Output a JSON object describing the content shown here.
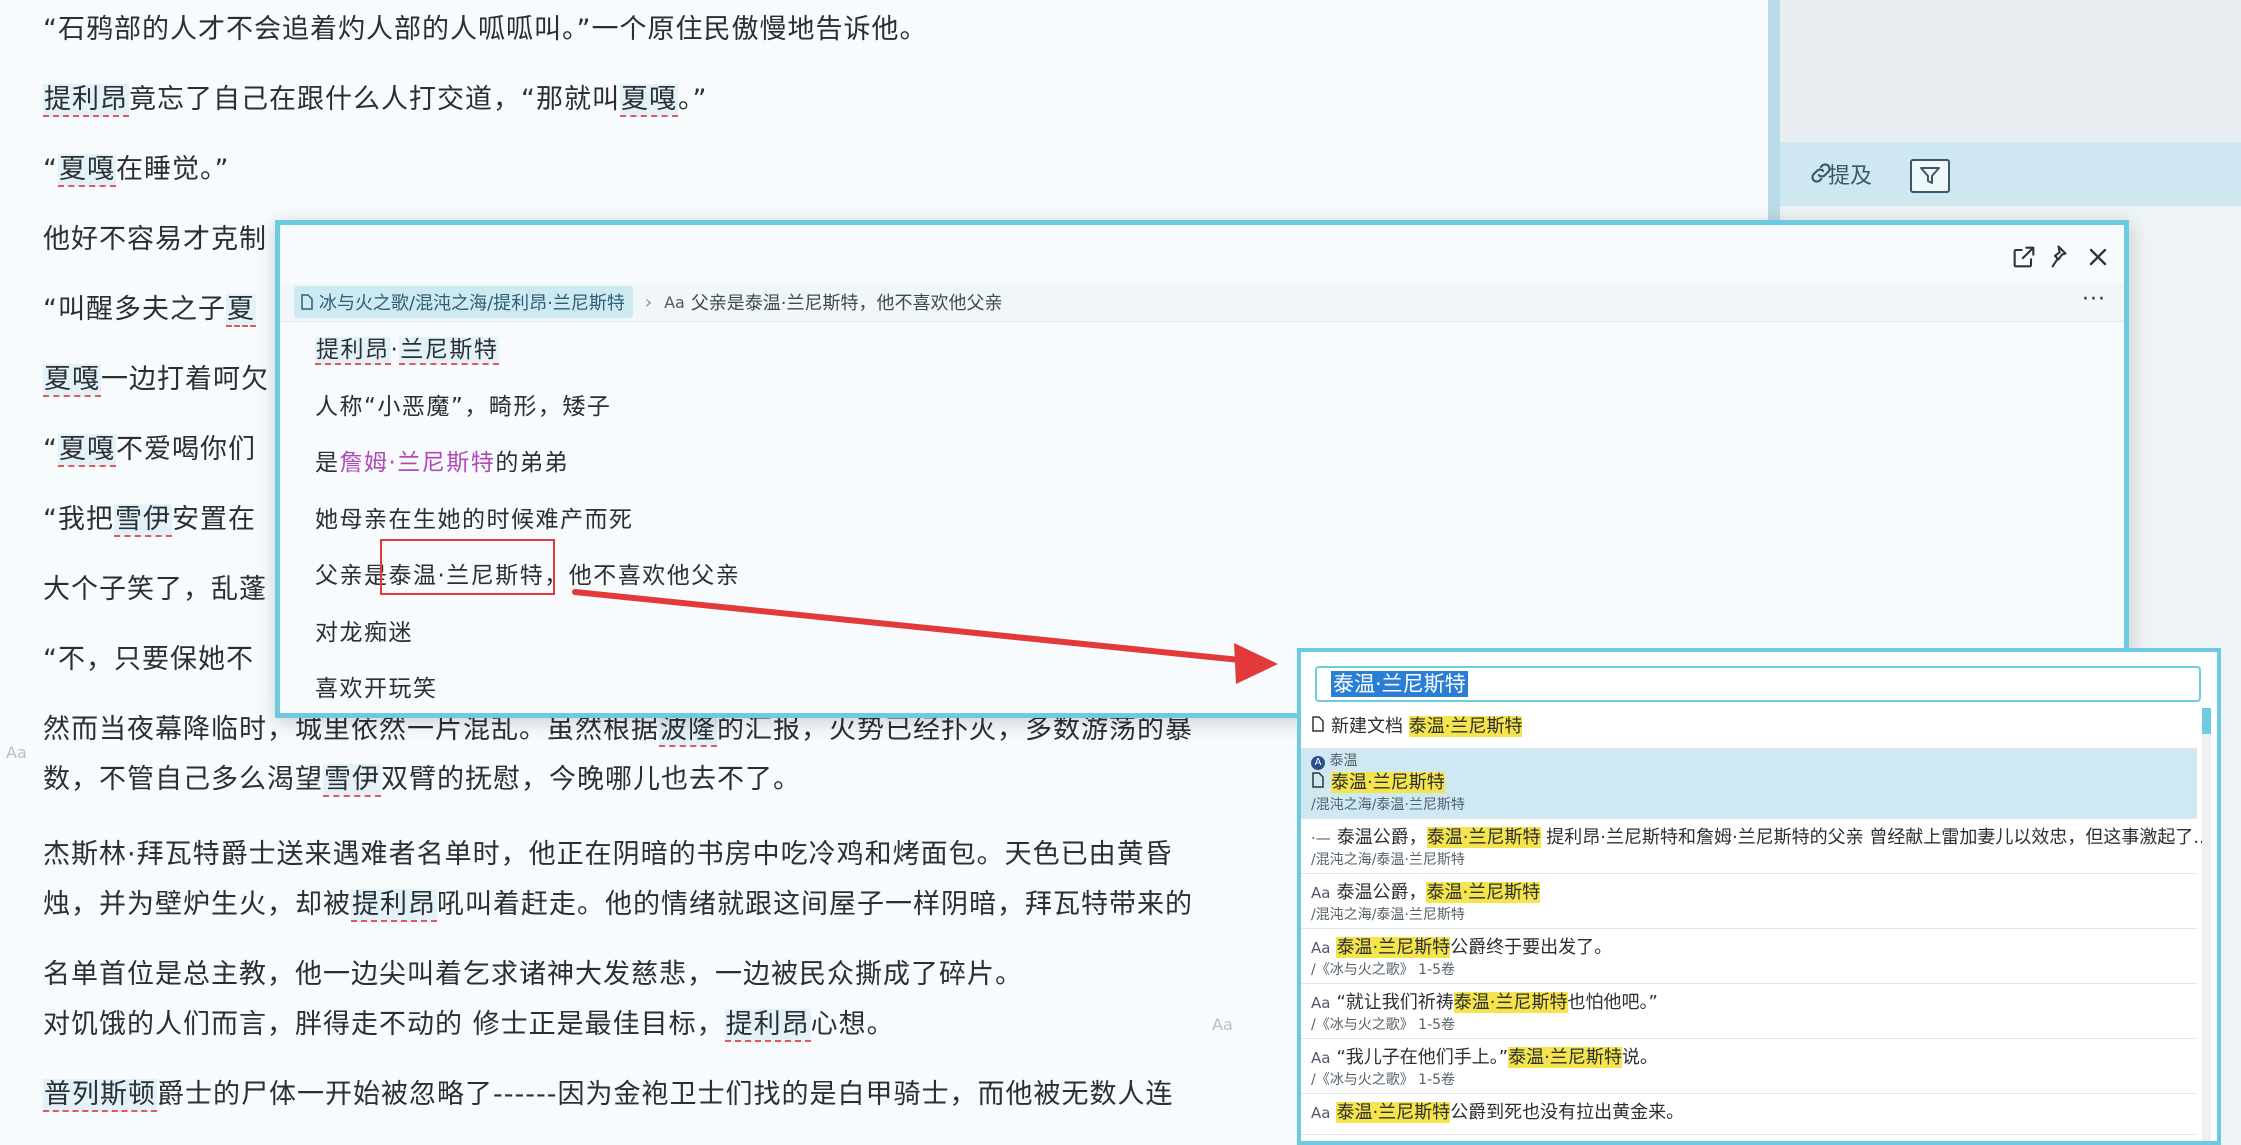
{
  "document": {
    "lines": [
      {
        "parts": [
          {
            "t": "“石鸦部的人才不会追着灼人部的人呱呱叫。”一个原住民傲慢地告诉他。"
          }
        ]
      },
      {
        "parts": [
          {
            "t": "提利昂",
            "link": true
          },
          {
            "t": "竟忘了自己在跟什么人打交道，“那就叫"
          },
          {
            "t": "夏嘎",
            "link": true
          },
          {
            "t": "。”"
          }
        ]
      },
      {
        "parts": [
          {
            "t": "“"
          },
          {
            "t": "夏嘎",
            "link": true
          },
          {
            "t": "在睡觉。”"
          }
        ]
      },
      {
        "parts": [
          {
            "t": "他好不容易才克制"
          }
        ]
      },
      {
        "parts": [
          {
            "t": "“叫醒多夫之子"
          },
          {
            "t": "夏",
            "link": true
          }
        ]
      },
      {
        "parts": [
          {
            "t": "夏嘎",
            "link": true
          },
          {
            "t": "一边打着呵欠"
          }
        ]
      },
      {
        "parts": [
          {
            "t": "“"
          },
          {
            "t": "夏嘎",
            "link": true
          },
          {
            "t": "不爱喝你们"
          }
        ]
      },
      {
        "parts": [
          {
            "t": "“我把"
          },
          {
            "t": "雪伊",
            "link": true
          },
          {
            "t": "安置在"
          }
        ]
      },
      {
        "parts": [
          {
            "t": "大个子笑了，乱蓬"
          }
        ]
      },
      {
        "parts": [
          {
            "t": "“不，只要保她不"
          }
        ]
      },
      {
        "parts": [
          {
            "t": "然而当夜幕降临时，城里依然一片混乱。虽然根据"
          },
          {
            "t": "波隆",
            "link": true
          },
          {
            "t": "的汇报，火势已经扑灭，多数游荡的暴"
          }
        ]
      },
      {
        "parts": [
          {
            "t": "数，不管自己多么渴望"
          },
          {
            "t": "雪伊",
            "link": true
          },
          {
            "t": "双臂的抚慰，今晚哪儿也去不了。"
          }
        ]
      },
      {
        "parts": [
          {
            "t": "杰斯林·拜瓦特爵士送来遇难者名单时，他正在阴暗的书房中吃冷鸡和烤面包。天色已由黄昏"
          }
        ]
      },
      {
        "parts": [
          {
            "t": "烛，并为壁炉生火，却被"
          },
          {
            "t": "提利昂",
            "link": true
          },
          {
            "t": "吼叫着赶走。他的情绪就跟这间屋子一样阴暗，拜瓦特带来的"
          }
        ]
      },
      {
        "parts": [
          {
            "t": "名单首位是总主教，他一边尖叫着乞求诸神大发慈悲，一边被民众撕成了碎片。"
          }
        ]
      },
      {
        "parts": [
          {
            "t": "对饥饿的人们而言，胖得走不动的 修士正是最佳目标，"
          },
          {
            "t": "提利昂",
            "link": true
          },
          {
            "t": "心想。"
          }
        ]
      },
      {
        "parts": [
          {
            "t": "普列斯顿",
            "link": true
          },
          {
            "t": "爵士的尸体一开始被忽略了------因为金袍卫士们找的是白甲骑士，而他被无数人连"
          }
        ]
      }
    ],
    "aa_marks": [
      "Aa",
      "Aa"
    ]
  },
  "sidebar": {
    "mentions_label": "提及",
    "icons": [
      "link-icon",
      "filter-icon"
    ]
  },
  "popover": {
    "breadcrumb_doc": "冰与火之歌/混沌之海/提利昂·兰尼斯特",
    "breadcrumb_block_prefix": "Aa",
    "breadcrumb_block": "父亲是泰温·兰尼斯特，他不喜欢他父亲",
    "more": "···",
    "lines": [
      {
        "parts": [
          {
            "t": "提利昂",
            "link": true
          },
          {
            "t": "·"
          },
          {
            "t": "兰尼斯特",
            "link": true
          }
        ]
      },
      {
        "parts": [
          {
            "t": "人称“小恶魔”，畸形，矮子"
          }
        ]
      },
      {
        "parts": [
          {
            "t": "是"
          },
          {
            "t": "詹姆·兰尼斯特",
            "purple": true
          },
          {
            "t": "的弟弟"
          }
        ]
      },
      {
        "parts": [
          {
            "t": "她母亲在生她的时候难产而死"
          }
        ]
      },
      {
        "parts": [
          {
            "t": "父亲是泰温·兰尼斯特，他不喜欢他父亲"
          }
        ]
      },
      {
        "parts": [
          {
            "t": "对龙痴迷"
          }
        ]
      },
      {
        "parts": [
          {
            "t": "喜欢开玩笑"
          }
        ]
      }
    ]
  },
  "search": {
    "query": "泰温·兰尼斯特",
    "results": [
      {
        "kind": "new-doc",
        "line": [
          {
            "t": "新建文档 "
          },
          {
            "t": "泰温·兰尼斯特",
            "hl": true
          }
        ],
        "path": ""
      },
      {
        "kind": "doc",
        "selected": true,
        "badge": "A",
        "badge_text": "泰温",
        "line": [
          {
            "t": "泰温·兰尼斯特",
            "hl": true
          }
        ],
        "path": "/混沌之海/泰温·兰尼斯特"
      },
      {
        "kind": "list",
        "line": [
          {
            "t": "泰温公爵，"
          },
          {
            "t": "泰温·兰尼斯特",
            "hl": true
          },
          {
            "t": " 提利昂·兰尼斯特和詹姆·兰尼斯特的父亲 曾经献上雷加妻儿以效忠，但这事激起了..."
          }
        ],
        "path": "/混沌之海/泰温·兰尼斯特"
      },
      {
        "kind": "aa",
        "line": [
          {
            "t": "泰温公爵，"
          },
          {
            "t": "泰温·兰尼斯特",
            "hl": true
          }
        ],
        "path": "/混沌之海/泰温·兰尼斯特"
      },
      {
        "kind": "aa",
        "line": [
          {
            "t": "泰温·兰尼斯特",
            "hl": true
          },
          {
            "t": "公爵终于要出发了。"
          }
        ],
        "path": "/《冰与火之歌》 1-5卷"
      },
      {
        "kind": "aa",
        "line": [
          {
            "t": "“就让我们祈祷"
          },
          {
            "t": "泰温·兰尼斯特",
            "hl": true
          },
          {
            "t": "也怕他吧。”"
          }
        ],
        "path": "/《冰与火之歌》 1-5卷"
      },
      {
        "kind": "aa",
        "line": [
          {
            "t": "“我儿子在他们手上。”"
          },
          {
            "t": "泰温·兰尼斯特",
            "hl": true
          },
          {
            "t": "说。"
          }
        ],
        "path": "/《冰与火之歌》 1-5卷"
      },
      {
        "kind": "aa",
        "line": [
          {
            "t": "泰温·兰尼斯特",
            "hl": true
          },
          {
            "t": "公爵到死也没有拉出黄金来。"
          }
        ],
        "path": ""
      }
    ]
  },
  "colors": {
    "accent": "#6ccbe0",
    "highlight": "#f5e44b",
    "arrow": "#e23a3a",
    "purple": "#b04ab8"
  }
}
